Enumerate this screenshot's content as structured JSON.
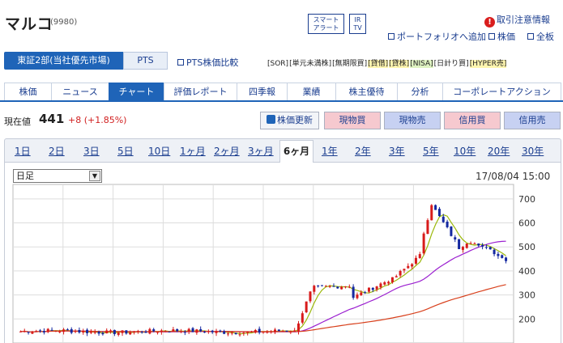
{
  "header": {
    "name": "マルコ",
    "code": "(9980)",
    "alert_line1": "スマート",
    "alert_line2": "アラート",
    "irtv_line1": "IR",
    "irtv_line2": "TV",
    "order_info": "取引注意情報",
    "portfolio_link": "ポートフォリオへ追加",
    "stock_board_link": "株価",
    "full_board_link": "全板"
  },
  "market": {
    "market_tab": "東証2部(当社優先市場)",
    "pts_tab": "PTS",
    "pts_compare": "PTS株価比較",
    "badges": [
      "[SOR]",
      "[単元未満株]",
      "[無期限買]",
      "[貸借]",
      "[貸株]",
      "[NISA]",
      "[日計り買]",
      "[HYPER売]"
    ]
  },
  "nav": {
    "tabs": [
      "株価",
      "ニュース",
      "チャート",
      "評価レポート",
      "四季報",
      "業績",
      "株主優待",
      "分析",
      "コーポレートアクション"
    ],
    "active": 2
  },
  "quote": {
    "label": "現在値",
    "price": "441",
    "change": "+8 (+1.85%)",
    "refresh": "株価更新",
    "buy_spot": "現物買",
    "sell_spot": "現物売",
    "buy_margin": "信用買",
    "sell_margin": "信用売"
  },
  "ranges": {
    "items": [
      "1日",
      "2日",
      "3日",
      "5日",
      "10日",
      "1ヶ月",
      "2ヶ月",
      "3ヶ月",
      "6ヶ月",
      "1年",
      "2年",
      "3年",
      "5年",
      "10年",
      "20年",
      "30年"
    ],
    "active": 8
  },
  "chart_controls": {
    "period": "日足",
    "date": "17/08/04 15:00"
  },
  "chart_data": {
    "type": "candlestick",
    "y_ticks": [
      200,
      300,
      400,
      500,
      600,
      700
    ],
    "ylim": [
      100,
      760
    ],
    "grid": true,
    "colors": {
      "up": "#d81b1b",
      "down": "#1428a0",
      "ma_short": "#9bb80a",
      "ma_mid": "#9b1fd0",
      "ma_long": "#d8401c"
    },
    "n": 125
  }
}
